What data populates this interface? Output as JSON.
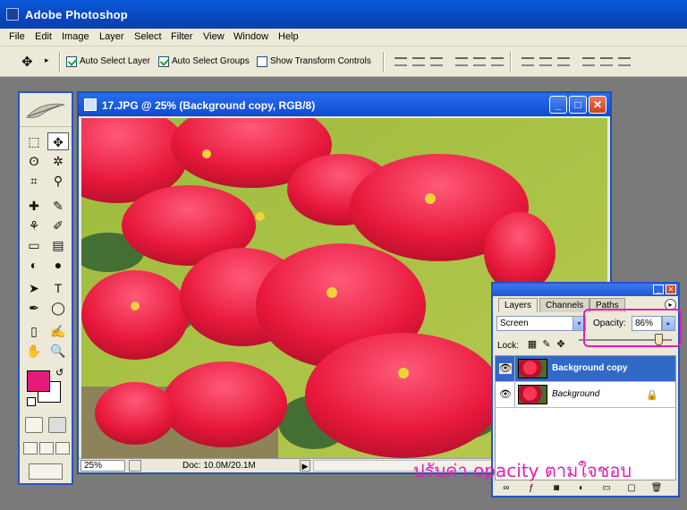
{
  "window": {
    "title": "Adobe Photoshop"
  },
  "menu": [
    "File",
    "Edit",
    "Image",
    "Layer",
    "Select",
    "Filter",
    "View",
    "Window",
    "Help"
  ],
  "options": {
    "tool_arrow": "▸",
    "auto_select_layer": "Auto Select Layer",
    "auto_select_groups": "Auto Select Groups",
    "show_transform_controls": "Show Transform Controls"
  },
  "toolbox": {
    "tools": [
      "⬚",
      "✥",
      "ʘ",
      "✲",
      "⌗",
      "⚲",
      "✚",
      "✎",
      "⚘",
      "✐",
      "▭",
      "▤",
      "◐",
      "●",
      "➤",
      "T",
      "✒",
      "◯",
      "▯",
      "✍",
      "✋",
      "🔍"
    ],
    "swap_icon": "↺",
    "colors": {
      "foreground": "#e61a7d",
      "background": "#ffffff"
    }
  },
  "document": {
    "title": "17.JPG @ 25% (Background copy, RGB/8)",
    "minimize": "_",
    "maximize": "□",
    "close": "✕",
    "zoom": "25%",
    "doc_info": "Doc: 10.0M/20.1M",
    "status_arrow": "▶"
  },
  "layers_panel": {
    "minimize": "_",
    "close": "✕",
    "menu_arrow": "▸",
    "tabs": [
      "Layers",
      "Channels",
      "Paths"
    ],
    "blend_mode": "Screen",
    "dropdown_arrow": "▾",
    "opacity_label": "Opacity:",
    "opacity_value": "86%",
    "opacity_fraction": 0.86,
    "lock_label": "Lock:",
    "lock_icons": [
      "▦",
      "✎",
      "✥"
    ],
    "layers": [
      {
        "name": "Background copy",
        "eye": "👁",
        "selected": true
      },
      {
        "name": "Background",
        "eye": "👁",
        "lock": "🔒",
        "selected": false
      }
    ],
    "footer_icons": [
      "∞",
      "ƒ",
      "◙",
      "◐",
      "▭",
      "▢",
      "🗑"
    ]
  },
  "annotation": "ปรับค่า opacity ตามใจชอบ"
}
